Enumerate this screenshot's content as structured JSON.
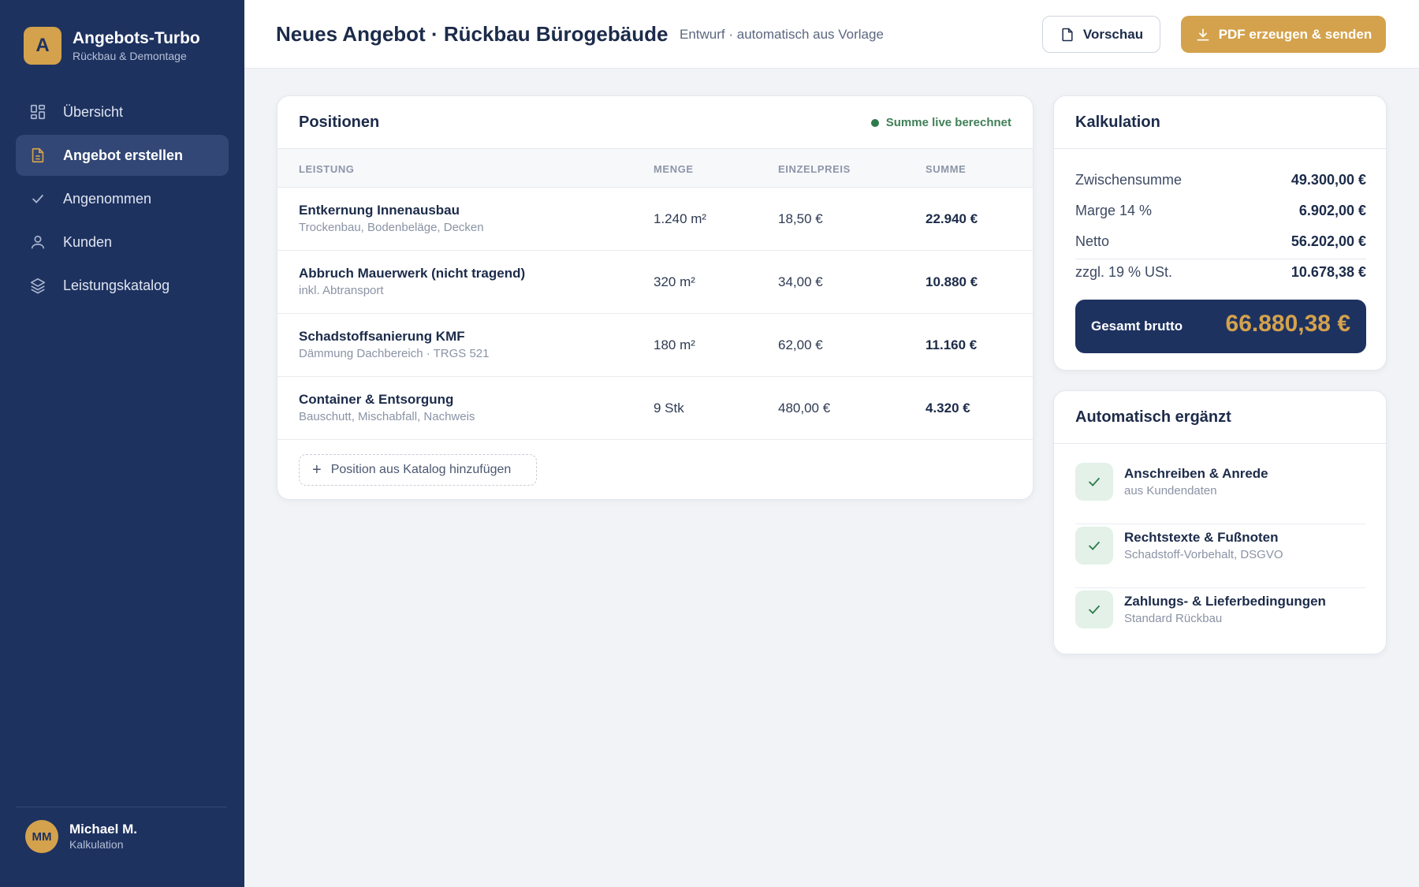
{
  "brand": {
    "logo_letter": "A",
    "name": "Angebots-Turbo",
    "subtitle": "Rückbau & Demontage"
  },
  "nav": [
    {
      "label": "Übersicht",
      "icon": "grid-icon",
      "active": false
    },
    {
      "label": "Angebot erstellen",
      "icon": "document-icon",
      "active": true
    },
    {
      "label": "Angenommen",
      "icon": "check-icon",
      "active": false
    },
    {
      "label": "Kunden",
      "icon": "user-icon",
      "active": false
    },
    {
      "label": "Leistungskatalog",
      "icon": "layers-icon",
      "active": false
    }
  ],
  "user": {
    "initials": "MM",
    "name": "Michael M.",
    "role": "Kalkulation"
  },
  "header": {
    "title": "Neues Angebot · Rückbau Bürogebäude",
    "subtitle": "Entwurf · automatisch aus Vorlage",
    "preview_label": "Vorschau",
    "primary_label": "PDF erzeugen & senden"
  },
  "positions": {
    "title": "Positionen",
    "live_label": "Summe live berechnet",
    "columns": {
      "service": "LEISTUNG",
      "quantity": "MENGE",
      "unit_price": "EINZELPREIS",
      "sum": "SUMME"
    },
    "rows": [
      {
        "name": "Entkernung Innenausbau",
        "desc": "Trockenbau, Bodenbeläge, Decken",
        "qty": "1.240 m²",
        "price": "18,50 €",
        "sum": "22.940 €"
      },
      {
        "name": "Abbruch Mauerwerk (nicht tragend)",
        "desc": "inkl. Abtransport",
        "qty": "320 m²",
        "price": "34,00 €",
        "sum": "10.880 €"
      },
      {
        "name": "Schadstoffsanierung KMF",
        "desc": "Dämmung Dachbereich · TRGS 521",
        "qty": "180 m²",
        "price": "62,00 €",
        "sum": "11.160 €"
      },
      {
        "name": "Container & Entsorgung",
        "desc": "Bauschutt, Mischabfall, Nachweis",
        "qty": "9 Stk",
        "price": "480,00 €",
        "sum": "4.320 €"
      }
    ],
    "add_label": "Position aus Katalog hinzufügen"
  },
  "calculation": {
    "title": "Kalkulation",
    "rows": [
      {
        "label": "Zwischensumme",
        "value": "49.300,00 €"
      },
      {
        "label": "Marge 14 %",
        "value": "6.902,00 €"
      },
      {
        "label": "Netto",
        "value": "56.202,00 €"
      },
      {
        "label": "zzgl. 19 % USt.",
        "value": "10.678,38 €"
      }
    ],
    "total_label": "Gesamt brutto",
    "total_value": "66.880,38 €"
  },
  "auto": {
    "title": "Automatisch ergänzt",
    "items": [
      {
        "title": "Anschreiben & Anrede",
        "sub": "aus Kundendaten"
      },
      {
        "title": "Rechtstexte & Fußnoten",
        "sub": "Schadstoff-Vorbehalt, DSGVO"
      },
      {
        "title": "Zahlungs- & Lieferbedingungen",
        "sub": "Standard Rückbau"
      }
    ]
  },
  "colors": {
    "sidebar": "#1e3260",
    "accent": "#d4a24c",
    "success": "#2f7a4c",
    "background": "#f1f3f6"
  }
}
